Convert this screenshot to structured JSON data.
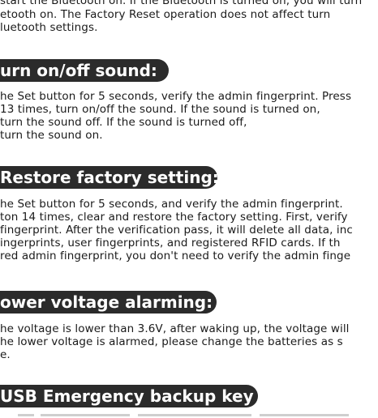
{
  "top": {
    "line_partial": "start the Bluetooth on. If the Bluetooth is turned on, you will turn",
    "line2": "etooth on. The Factory Reset operation does not affect turn",
    "line3": "luetooth settings."
  },
  "sections": [
    {
      "heading": "urn on/off sound:",
      "lines": [
        "he Set button for 5 seconds, verify the admin fingerprint. Press",
        "13 times, turn on/off the sound. If the sound is turned on,",
        " turn the sound off. If the sound is turned off,",
        " turn the sound on."
      ]
    },
    {
      "heading": "Restore factory setting:",
      "lines": [
        "he Set button for 5 seconds, and verify the admin fingerprint.",
        "ton 14 times, clear and restore the factory setting. First, verify",
        "fingerprint. After the verification pass, it will delete all data, inc",
        "ingerprints, user fingerprints, and registered RFID cards. If th",
        "red admin fingerprint, you don't need to verify the admin finge"
      ]
    },
    {
      "heading": "ower voltage alarming:",
      "lines": [
        "he voltage is lower than 3.6V, after waking up, the voltage will",
        "he lower voltage is alarmed, please change the batteries as s",
        "e."
      ]
    },
    {
      "heading": "USB Emergency backup key",
      "lines": []
    }
  ]
}
